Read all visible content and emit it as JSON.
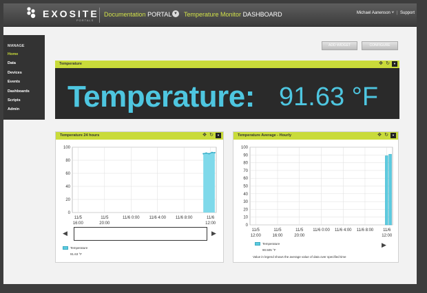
{
  "header": {
    "logo_text": "EXOSITE",
    "logo_sub": "PORTALS",
    "portal_title_a": "Documentation",
    "portal_title_b": "PORTAL",
    "dashboard_title_a": "Temperature Monitor",
    "dashboard_title_b": "DASHBOARD",
    "user_name": "Michael Aanenson",
    "user_caret": "˅",
    "separator": "|",
    "support_label": "Support"
  },
  "sidebar": {
    "title": "MANAGE",
    "items": [
      {
        "label": "Home",
        "active": true
      },
      {
        "label": "Data",
        "active": false
      },
      {
        "label": "Devices",
        "active": false
      },
      {
        "label": "Events",
        "active": false
      },
      {
        "label": "Dashboards",
        "active": false
      },
      {
        "label": "Scripts",
        "active": false
      },
      {
        "label": "Admin",
        "active": false
      }
    ]
  },
  "toolbar": {
    "add_widget_label": "ADD WIDGET",
    "configure_label": "CONFIGURE"
  },
  "widgets": {
    "temperature": {
      "title": "Temperature",
      "label": "Temperature:",
      "value": "91.63 °F"
    },
    "temp24": {
      "title": "Temperature 24 hours",
      "legend_name": "Temperature",
      "legend_value": "91.63 °F"
    },
    "avg": {
      "title": "Temperature Average - Hourly",
      "legend_name": "Temperature",
      "legend_value": "90.505 °F",
      "footnote": "Value in legend shows the average value of data over specified time"
    }
  },
  "icons": {
    "move": "move-icon",
    "refresh": "refresh-icon",
    "collapse": "collapse-icon",
    "nav_left": "arrow-left-icon",
    "nav_right": "arrow-right-icon"
  },
  "colors": {
    "accent_green": "#c9db3a",
    "series_cyan": "#5ccbe0",
    "big_text_cyan": "#4ec6e0",
    "header_dark": "#4a4a4a"
  },
  "chart_data": [
    {
      "type": "area",
      "ylim": [
        0,
        100
      ],
      "yticks": [
        "0",
        "20",
        "40",
        "60",
        "80",
        "100"
      ],
      "xticks": [
        [
          "11/5",
          "16:00"
        ],
        [
          "11/5",
          "20:00"
        ],
        [
          "11/6 0:00"
        ],
        [
          "11/6 4:00"
        ],
        [
          "11/6 8:00"
        ],
        [
          "11/6",
          "12:00"
        ]
      ],
      "xrange": [
        0,
        20
      ],
      "series": [
        {
          "name": "Temperature",
          "points": [
            [
              18.2,
              90
            ],
            [
              18.6,
              91
            ],
            [
              19.0,
              90
            ],
            [
              19.4,
              92
            ],
            [
              19.8,
              91.6
            ]
          ]
        }
      ],
      "grid": true,
      "legend": "bottom-left"
    },
    {
      "type": "bar",
      "ylim": [
        0,
        100
      ],
      "yticks": [
        "0",
        "10",
        "20",
        "30",
        "40",
        "50",
        "60",
        "70",
        "80",
        "90",
        "100"
      ],
      "xticks": [
        [
          "11/5",
          "12:00"
        ],
        [
          "11/5",
          "16:00"
        ],
        [
          "11/5",
          "20:00"
        ],
        [
          "11/6 0:00"
        ],
        [
          "11/6 4:00"
        ],
        [
          "11/6 8:00"
        ],
        [
          "11/6",
          "12:00"
        ]
      ],
      "xrange": [
        0,
        24
      ],
      "series": [
        {
          "name": "Temperature",
          "points": [
            [
              23.0,
              89
            ],
            [
              23.6,
              91
            ]
          ]
        }
      ],
      "grid": true,
      "legend": "bottom-left"
    }
  ]
}
